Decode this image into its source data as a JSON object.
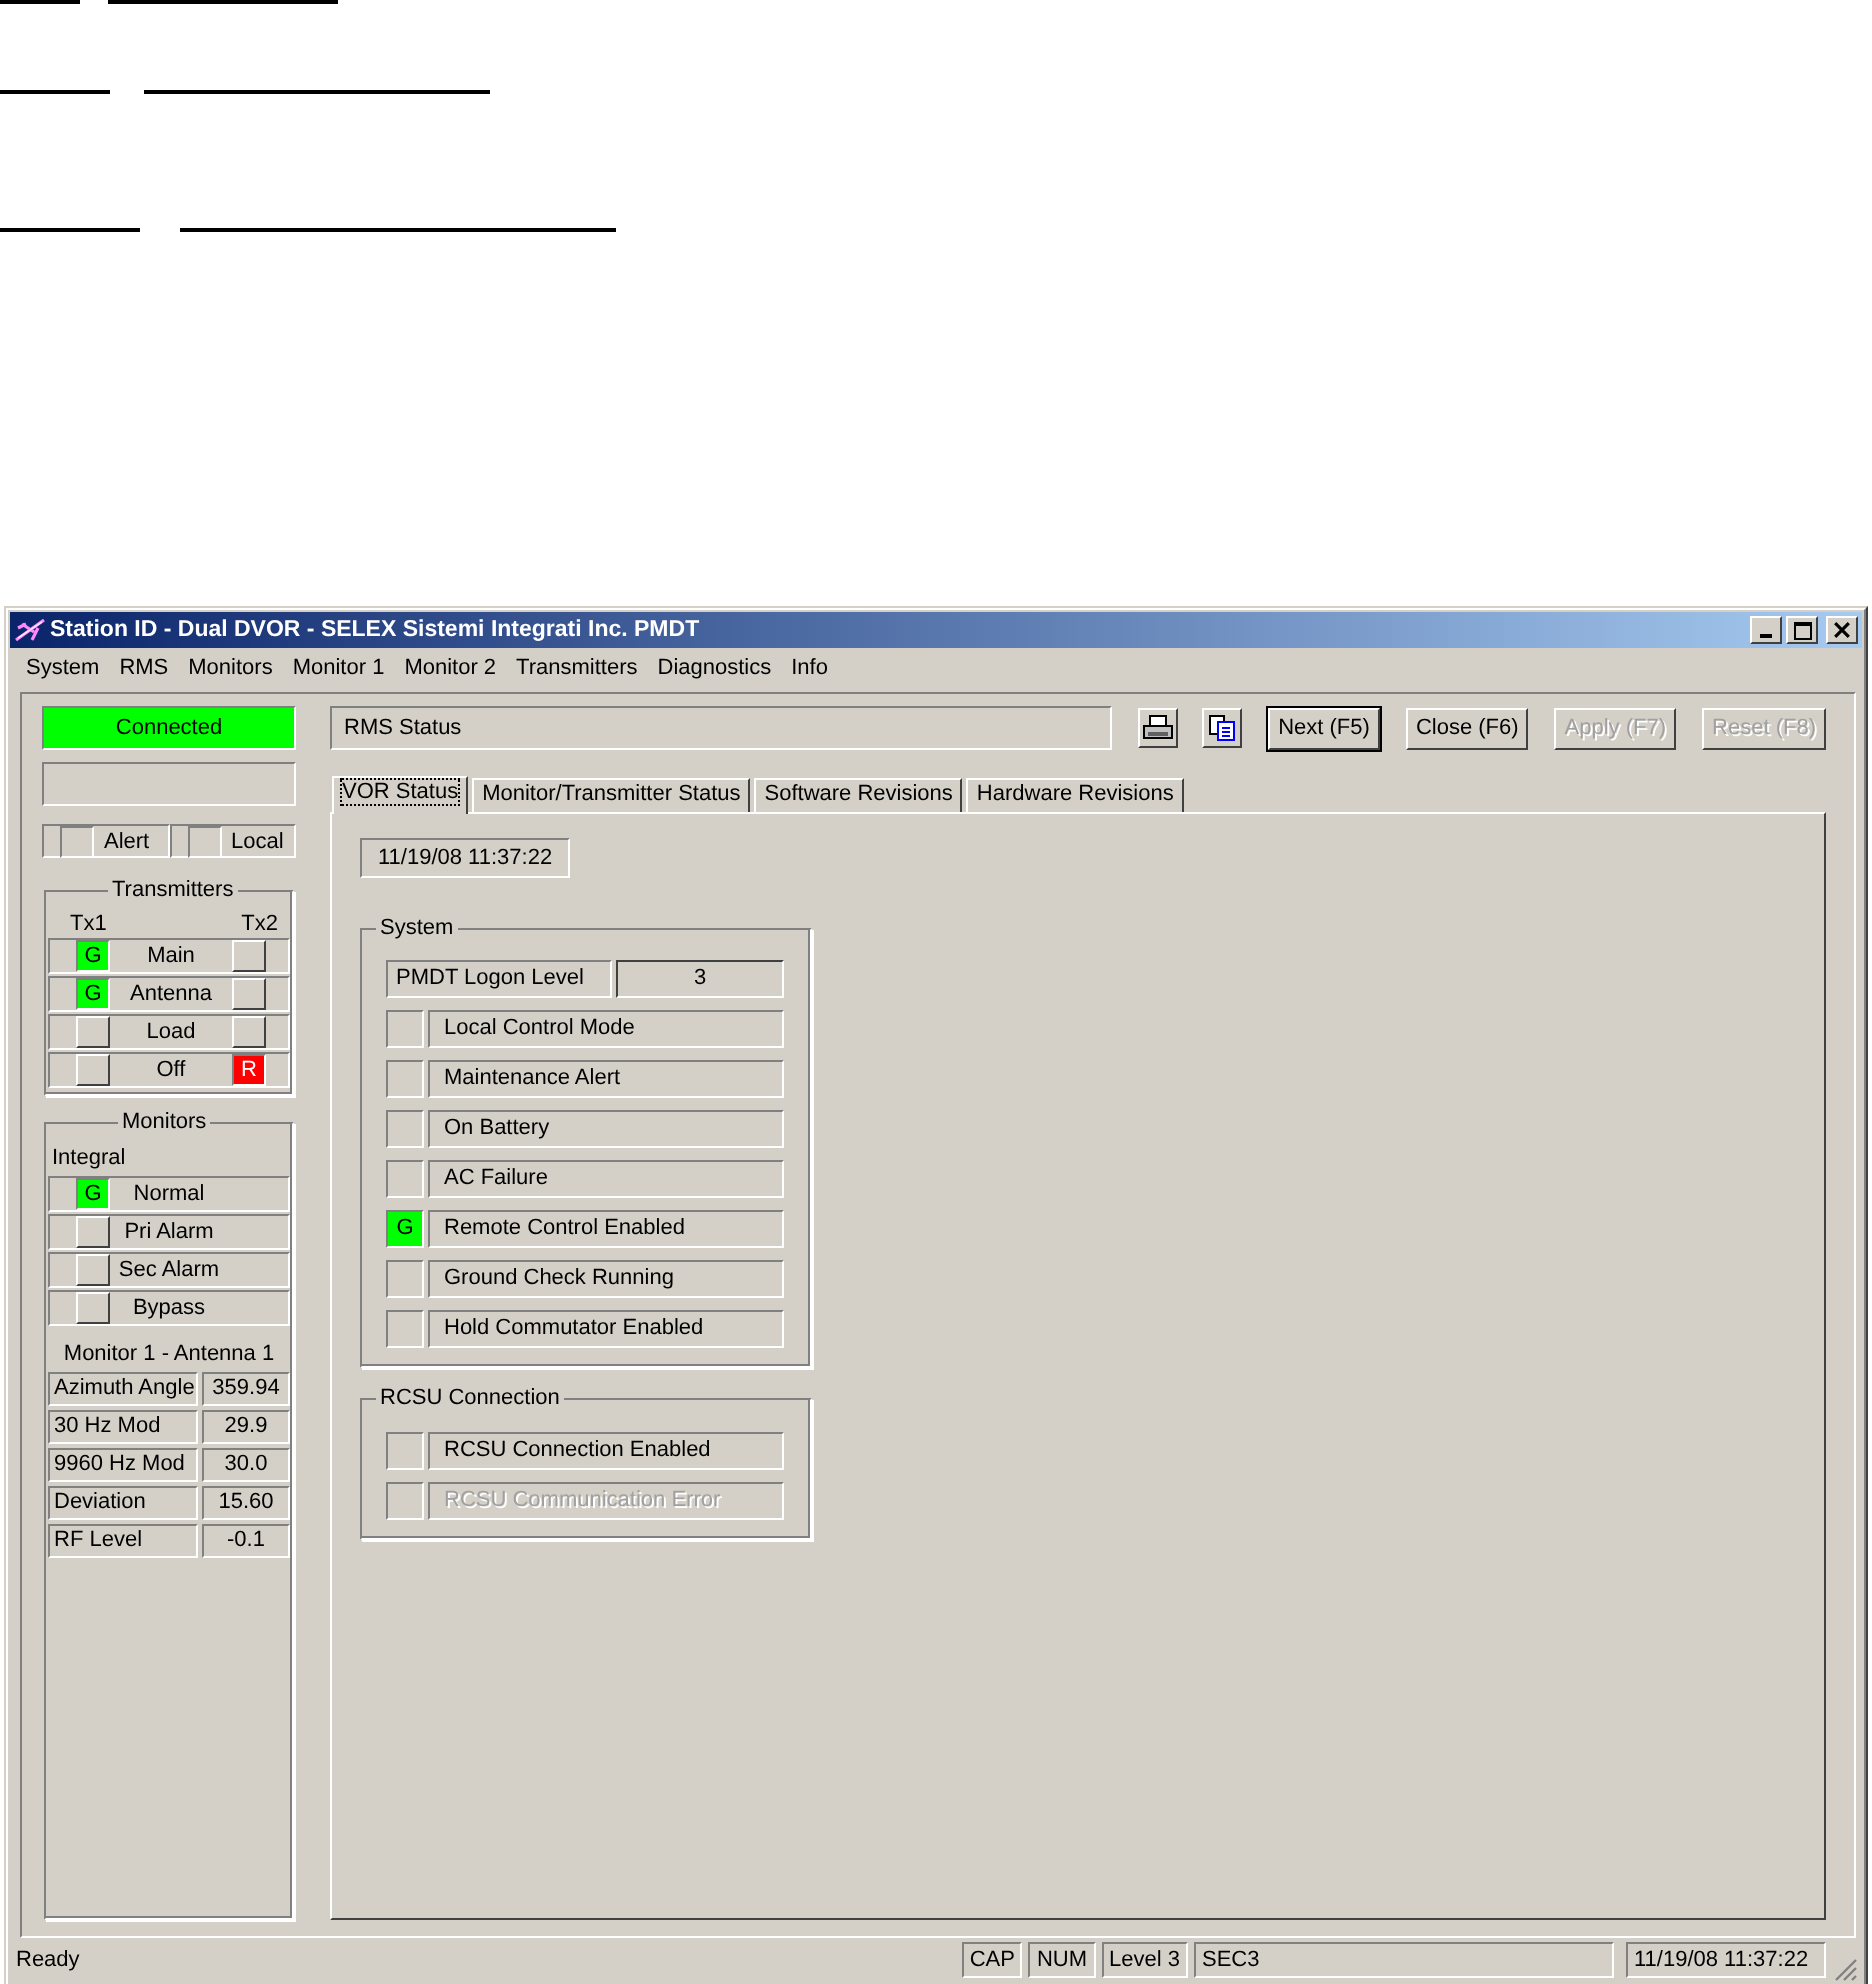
{
  "window": {
    "title": "Station ID - Dual DVOR - SELEX Sistemi Integrati Inc. PMDT"
  },
  "menu": [
    "System",
    "RMS",
    "Monitors",
    "Monitor 1",
    "Monitor 2",
    "Transmitters",
    "Diagnostics",
    "Info"
  ],
  "side": {
    "connection": {
      "label": "Connected",
      "on": true,
      "color": "#00ff00"
    },
    "flags": [
      {
        "label": "Alert",
        "on": false
      },
      {
        "label": "Local",
        "on": false
      }
    ],
    "transmitters": {
      "title": "Transmitters",
      "columns": [
        "Tx1",
        "Tx2"
      ],
      "rows": [
        {
          "label": "Main",
          "tx1": {
            "letter": "G",
            "on": true,
            "color": "#00ff00"
          },
          "tx2": {
            "on": false
          }
        },
        {
          "label": "Antenna",
          "tx1": {
            "letter": "G",
            "on": true,
            "color": "#00ff00"
          },
          "tx2": {
            "on": false
          }
        },
        {
          "label": "Load",
          "tx1": {
            "on": false
          },
          "tx2": {
            "on": false
          }
        },
        {
          "label": "Off",
          "tx1": {
            "on": false
          },
          "tx2": {
            "letter": "R",
            "on": true,
            "color": "#ff0000"
          }
        }
      ]
    },
    "monitors": {
      "title": "Monitors",
      "group": "Integral",
      "rows": [
        {
          "label": "Normal",
          "indicator": {
            "letter": "G",
            "on": true,
            "color": "#00ff00"
          }
        },
        {
          "label": "Pri Alarm",
          "indicator": {
            "on": false
          }
        },
        {
          "label": "Sec Alarm",
          "indicator": {
            "on": false
          }
        },
        {
          "label": "Bypass",
          "indicator": {
            "on": false
          }
        }
      ],
      "subtitle": "Monitor 1 - Antenna 1",
      "readings": [
        {
          "label": "Azimuth Angle",
          "value": "359.94"
        },
        {
          "label": "30 Hz Mod",
          "value": "29.9"
        },
        {
          "label": "9960 Hz Mod",
          "value": "30.0"
        },
        {
          "label": "Deviation",
          "value": "15.60"
        },
        {
          "label": "RF Level",
          "value": "-0.1"
        }
      ]
    }
  },
  "main": {
    "header": "RMS Status",
    "buttons": [
      {
        "label": "Next (F5)",
        "disabled": false
      },
      {
        "label": "Close (F6)",
        "disabled": false
      },
      {
        "label": "Apply (F7)",
        "disabled": true
      },
      {
        "label": "Reset (F8)",
        "disabled": true
      }
    ],
    "tabs": [
      {
        "label": "VOR Status",
        "selected": true
      },
      {
        "label": "Monitor/Transmitter Status",
        "selected": false
      },
      {
        "label": "Software Revisions",
        "selected": false
      },
      {
        "label": "Hardware Revisions",
        "selected": false
      }
    ],
    "timestamp": "11/19/08 11:37:22",
    "system": {
      "title": "System",
      "logon": {
        "label": "PMDT Logon Level",
        "value": "3"
      },
      "items": [
        {
          "label": "Local Control Mode",
          "indicator": {
            "on": false
          },
          "disabled": false
        },
        {
          "label": "Maintenance Alert",
          "indicator": {
            "on": false
          },
          "disabled": false
        },
        {
          "label": "On Battery",
          "indicator": {
            "on": false
          },
          "disabled": false
        },
        {
          "label": "AC Failure",
          "indicator": {
            "on": false
          },
          "disabled": false
        },
        {
          "label": "Remote Control Enabled",
          "indicator": {
            "letter": "G",
            "on": true,
            "color": "#00ff00"
          },
          "disabled": false
        },
        {
          "label": "Ground Check Running",
          "indicator": {
            "on": false
          },
          "disabled": false
        },
        {
          "label": "Hold Commutator Enabled",
          "indicator": {
            "on": false
          },
          "disabled": false
        }
      ]
    },
    "rcsu": {
      "title": "RCSU Connection",
      "items": [
        {
          "label": "RCSU Connection Enabled",
          "indicator": {
            "on": false
          },
          "disabled": false
        },
        {
          "label": "RCSU Communication Error",
          "indicator": {
            "on": false
          },
          "disabled": true
        }
      ]
    }
  },
  "status_bar": {
    "message": "Ready",
    "panes": [
      "CAP",
      "NUM",
      "Level 3",
      "SEC3"
    ],
    "time": "11/19/08 11:37:22"
  }
}
